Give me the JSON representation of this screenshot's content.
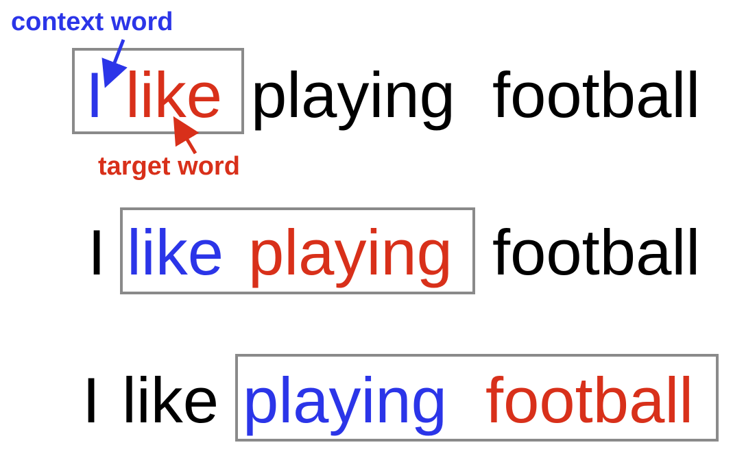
{
  "colors": {
    "context": "#2b35e8",
    "target": "#d8301a",
    "plain": "#000000",
    "window": "#8a8a8a"
  },
  "labels": {
    "context": "context word",
    "target": "target word"
  },
  "rows": [
    {
      "words": [
        "I",
        "like",
        "playing",
        "football"
      ],
      "context_index": 0,
      "target_index": 1
    },
    {
      "words": [
        "I",
        "like",
        "playing",
        "football"
      ],
      "context_index": 1,
      "target_index": 2
    },
    {
      "words": [
        "I",
        "like",
        "playing",
        "football"
      ],
      "context_index": 2,
      "target_index": 3
    }
  ]
}
